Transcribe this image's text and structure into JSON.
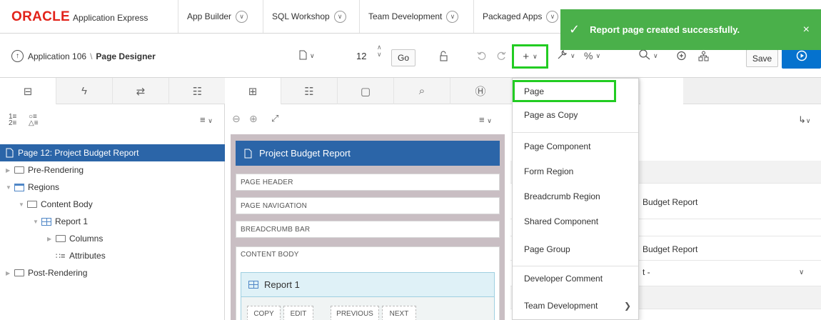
{
  "brand": {
    "logo_text": "ORACLE",
    "product": "Application Express"
  },
  "nav": {
    "tabs": [
      "App Builder",
      "SQL Workshop",
      "Team Development",
      "Packaged Apps"
    ]
  },
  "toast": {
    "message": "Report page created successfully.",
    "check": "✓",
    "close": "×"
  },
  "breadcrumb": {
    "app": "Application 106",
    "separator": "\\",
    "page": "Page Designer"
  },
  "toolbar": {
    "page_number": "12",
    "go_label": "Go",
    "plus_label": "+",
    "save_label": "Save"
  },
  "left_pane": {
    "tree": [
      {
        "label": "Page 12: Project Budget Report",
        "level": 0,
        "selected": true
      },
      {
        "label": "Pre-Rendering",
        "level": 0
      },
      {
        "label": "Regions",
        "level": 0
      },
      {
        "label": "Content Body",
        "level": 1
      },
      {
        "label": "Report 1",
        "level": 2
      },
      {
        "label": "Columns",
        "level": 3
      },
      {
        "label": "Attributes",
        "level": 3
      },
      {
        "label": "Post-Rendering",
        "level": 0
      }
    ]
  },
  "canvas": {
    "page_title": "Project Budget Report",
    "slots": [
      "PAGE HEADER",
      "PAGE NAVIGATION",
      "BREADCRUMB BAR",
      "CONTENT BODY"
    ],
    "report_title": "Report 1",
    "button_slots": [
      "COPY",
      "EDIT",
      "PREVIOUS",
      "NEXT"
    ]
  },
  "right_pane": {
    "name_value": "Budget Report",
    "title_value": "Budget Report",
    "select_value": "t -"
  },
  "create_menu": {
    "items": [
      {
        "label": "Page",
        "highlighted": true
      },
      {
        "label": "Page as Copy"
      },
      {
        "label": "Page Component"
      },
      {
        "label": "Form Region"
      },
      {
        "label": "Breadcrumb Region"
      },
      {
        "label": "Shared Component"
      },
      {
        "label": "Page Group"
      },
      {
        "label": "Developer Comment"
      },
      {
        "label": "Team Development",
        "submenu": true
      }
    ]
  },
  "colors": {
    "oracle_red": "#e2231a",
    "toast_green": "#4ab04a",
    "highlight_green": "#22cc22",
    "selected_blue": "#2b65a8",
    "run_blue": "#0572ce"
  }
}
